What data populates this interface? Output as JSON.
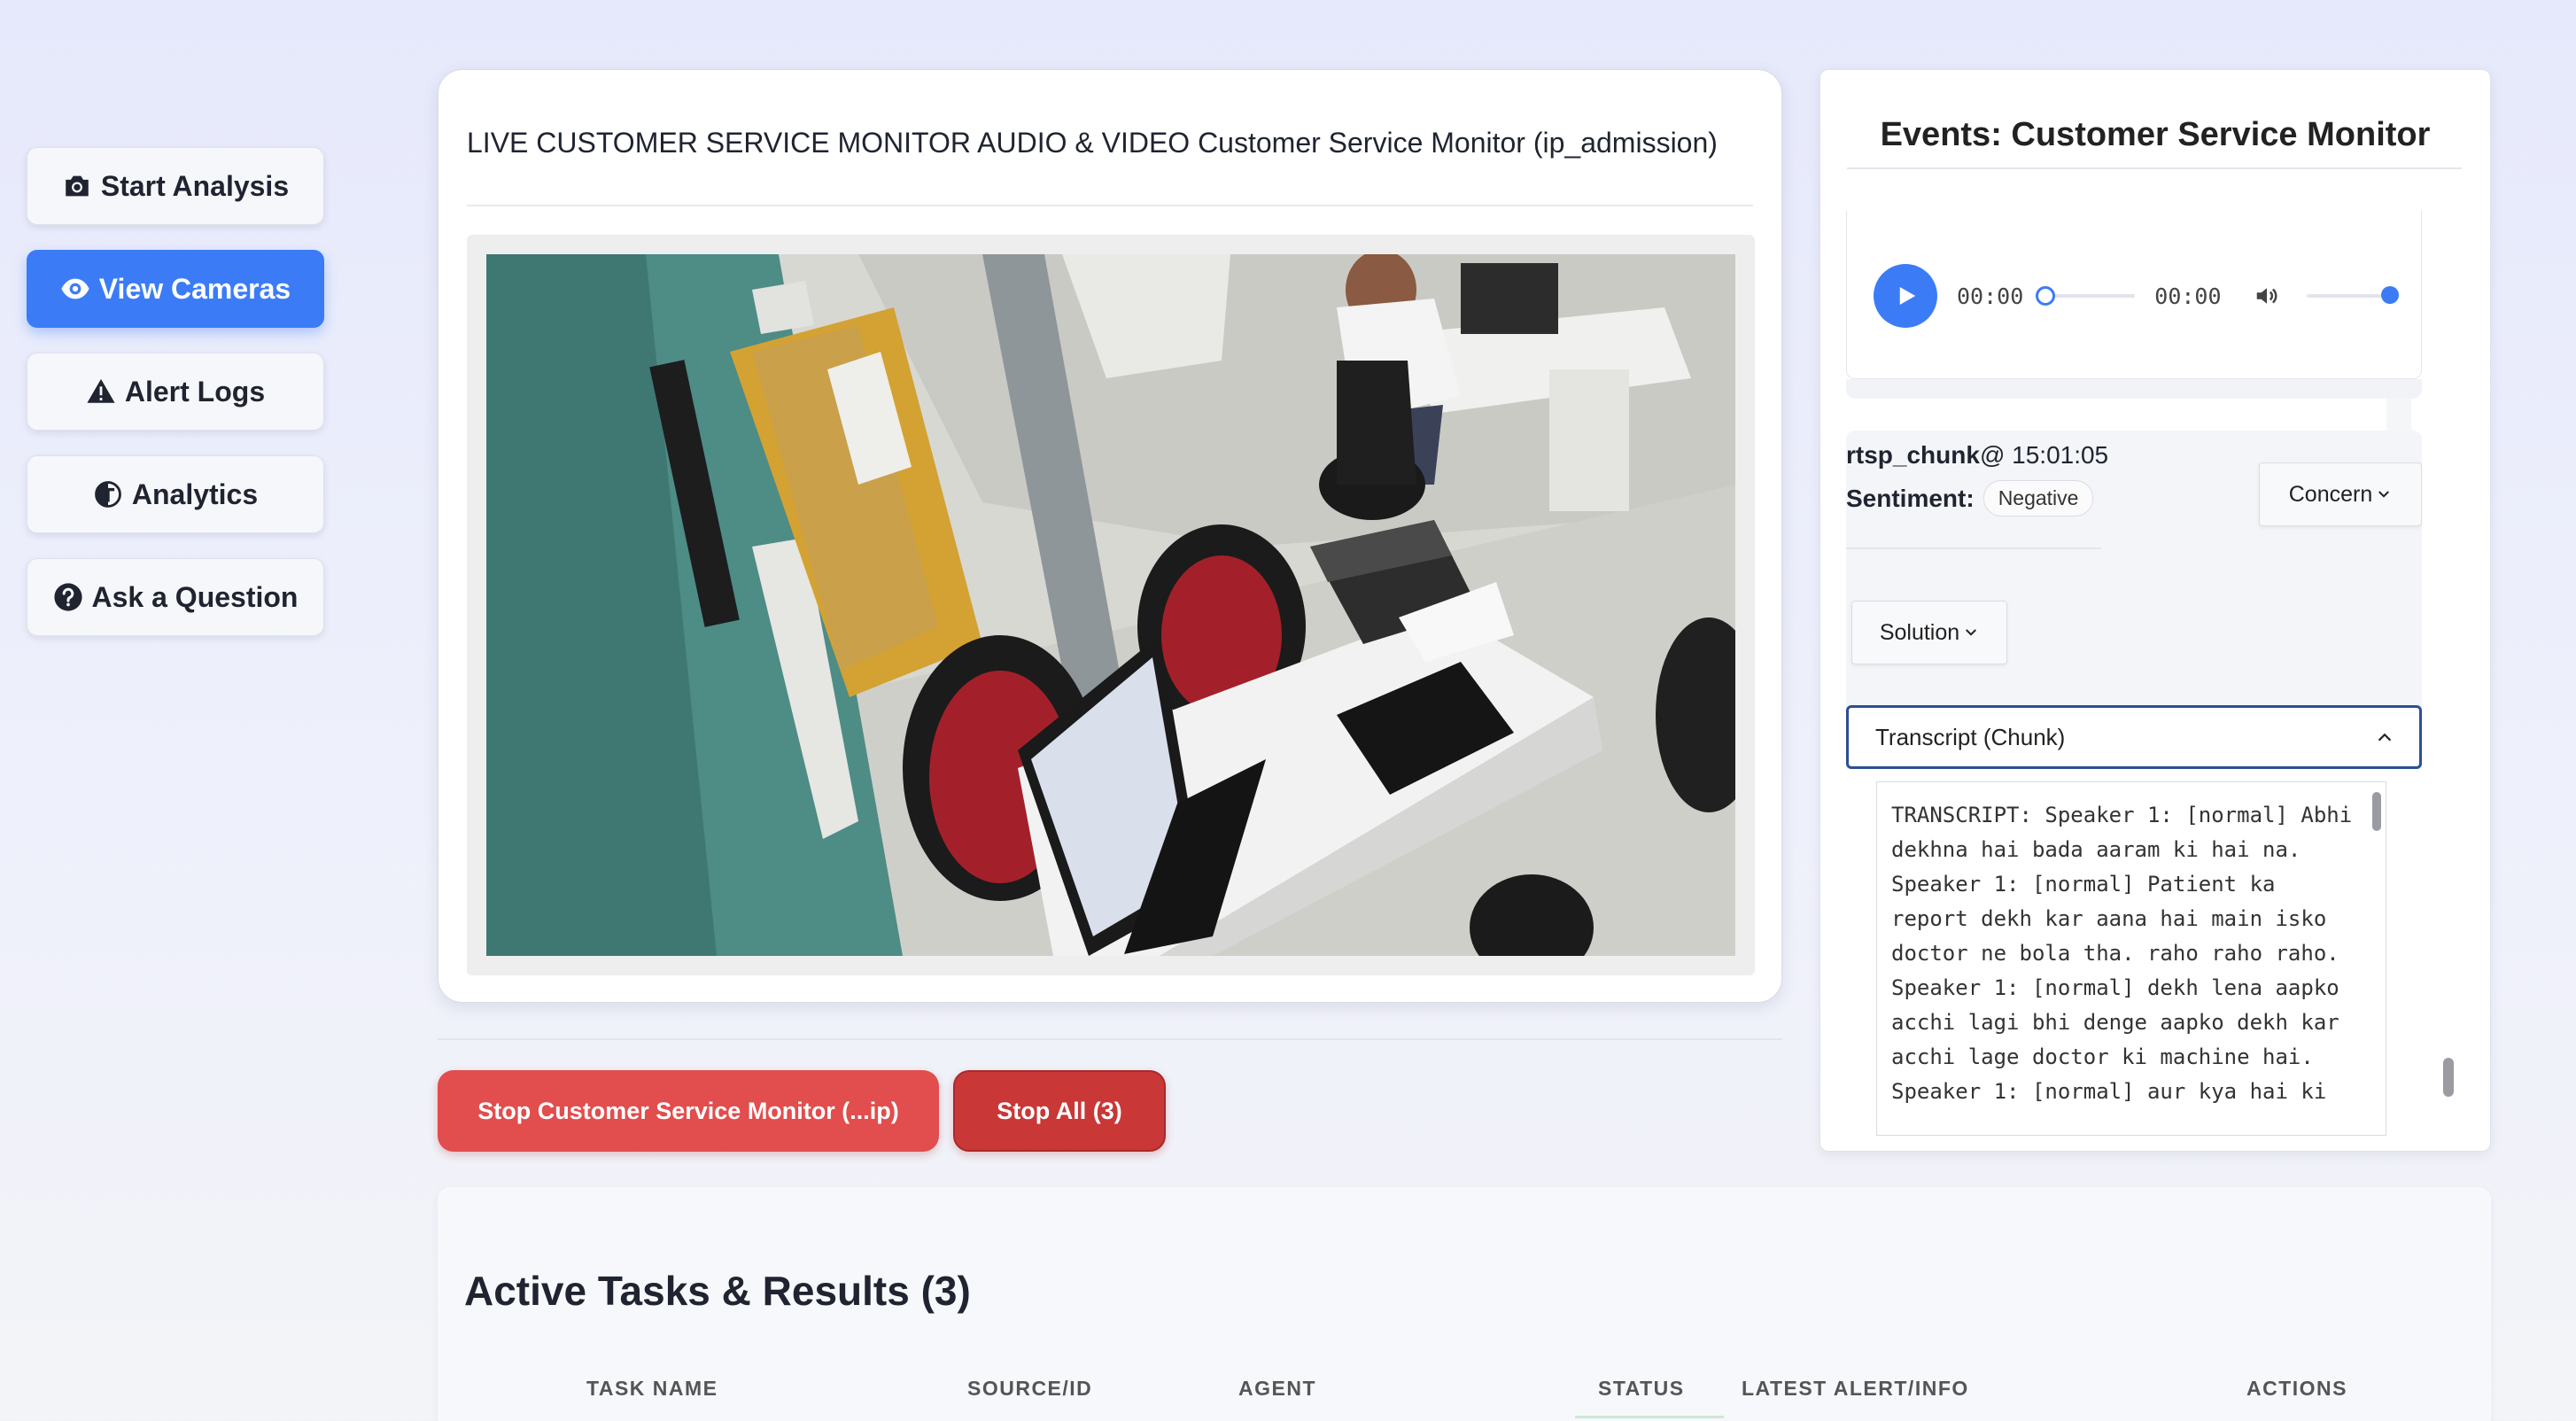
{
  "sidebar": {
    "items": [
      {
        "label": "Start Analysis",
        "icon": "camera-icon",
        "active": false
      },
      {
        "label": "View Cameras",
        "icon": "eye-icon",
        "active": true
      },
      {
        "label": "Alert Logs",
        "icon": "warning-icon",
        "active": false
      },
      {
        "label": "Analytics",
        "icon": "analytics-icon",
        "active": false
      },
      {
        "label": "Ask a Question",
        "icon": "question-icon",
        "active": false
      }
    ]
  },
  "video": {
    "title": "LIVE CUSTOMER SERVICE MONITOR AUDIO & VIDEO Customer Service Monitor (ip_admission)"
  },
  "actions": {
    "stop_one_label": "Stop Customer Service Monitor (...ip)",
    "stop_all_label": "Stop All (3)"
  },
  "events": {
    "title": "Events: Customer Service Monitor",
    "audio": {
      "current_time": "00:00",
      "duration": "00:00",
      "progress_fraction": 0,
      "volume_fraction": 1
    },
    "event": {
      "source": "rtsp_chunk",
      "time": "@ 15:01:05",
      "sentiment_label": "Sentiment:",
      "sentiment_value": "Negative",
      "concern_label": "Concern",
      "solution_label": "Solution",
      "transcript_label": "Transcript (Chunk)",
      "transcript_text": "TRANSCRIPT: Speaker 1: [normal] Abhi dekhna hai bada aaram ki hai na. Speaker 1: [normal] Patient ka report dekh kar aana hai main isko doctor ne bola tha. raho raho raho. Speaker 1: [normal] dekh lena aapko acchi lagi bhi denge aapko dekh kar acchi lage doctor ki machine hai. Speaker 1: [normal] aur kya hai ki"
    }
  },
  "tasks": {
    "title": "Active Tasks & Results (3)",
    "columns": [
      "TASK NAME",
      "SOURCE/ID",
      "AGENT",
      "STATUS",
      "LATEST ALERT/INFO",
      "ACTIONS"
    ]
  },
  "colors": {
    "accent": "#3b7cf6",
    "danger": "#e24d4d",
    "danger_dark": "#c93737",
    "focus_border": "#2b4f95"
  }
}
